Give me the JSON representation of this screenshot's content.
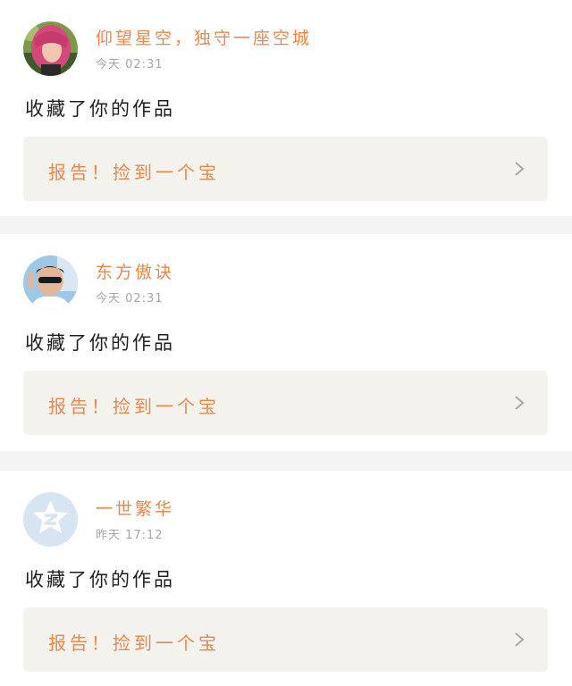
{
  "feed": {
    "items": [
      {
        "avatar": "avatar-pink-hair",
        "username": "仰望星空，独守一座空城",
        "timestamp": "今天 02:31",
        "action": "收藏了你的作品",
        "link_text": "报告！捡到一个宝",
        "link_icon": "chevron-right-icon"
      },
      {
        "avatar": "avatar-sunglasses-man",
        "username": "东方傲诀",
        "timestamp": "今天 02:31",
        "action": "收藏了你的作品",
        "link_text": "报告！捡到一个宝",
        "link_icon": "chevron-right-icon"
      },
      {
        "avatar": "avatar-default-qzone",
        "username": "一世繁华",
        "timestamp": "昨天 17:12",
        "action": "收藏了你的作品",
        "link_text": "报告！捡到一个宝",
        "link_icon": "chevron-right-icon"
      }
    ]
  },
  "colors": {
    "accent": "#e8884f",
    "text": "#1e1e1e",
    "muted": "#a6a6a6",
    "link_bg": "#f3f2ec",
    "separator": "#f4f4f4"
  }
}
